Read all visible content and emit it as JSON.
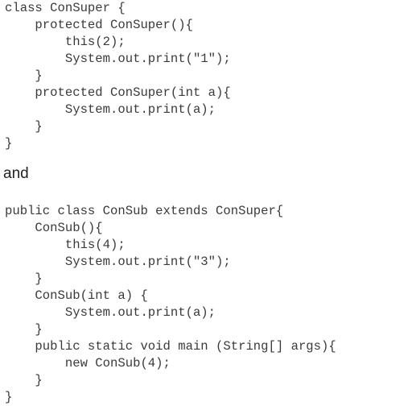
{
  "code_blocks": [
    {
      "name": "ConSuper",
      "lines": [
        "class ConSuper {",
        "    protected ConSuper(){",
        "        this(2);",
        "        System.out.print(\"1\");",
        "    }",
        "    protected ConSuper(int a){",
        "        System.out.print(a);",
        "    }",
        "}"
      ]
    },
    {
      "name": "ConSub",
      "lines": [
        "public class ConSub extends ConSuper{",
        "    ConSub(){",
        "        this(4);",
        "        System.out.print(\"3\");",
        "    }",
        "    ConSub(int a) {",
        "        System.out.print(a);",
        "    }",
        "    public static void main (String[] args){",
        "        new ConSub(4);",
        "    }",
        "}"
      ]
    }
  ],
  "separator_text": "and"
}
